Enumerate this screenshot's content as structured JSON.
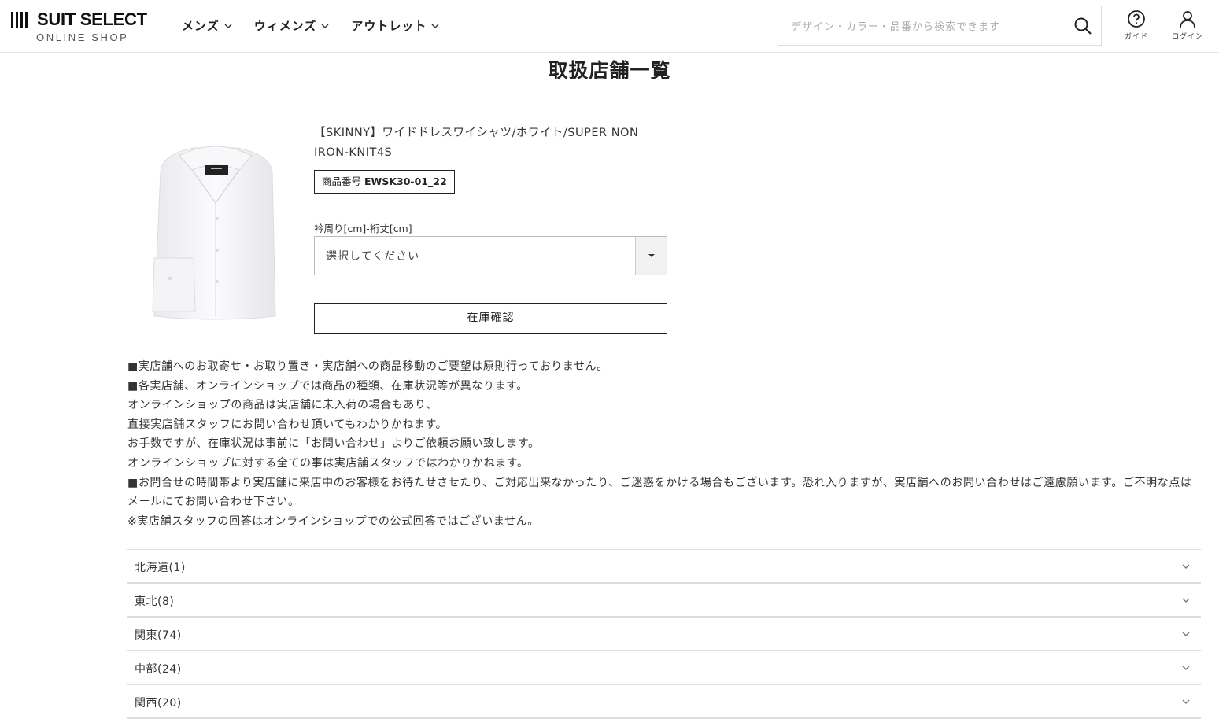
{
  "header": {
    "logo_main": "SUIT SELECT",
    "logo_sub": "ONLINE SHOP",
    "nav": [
      {
        "label": "メンズ"
      },
      {
        "label": "ウィメンズ"
      },
      {
        "label": "アウトレット"
      }
    ],
    "search_placeholder": "デザイン・カラー・品番から検索できます",
    "guide_label": "ガイド",
    "login_label": "ログイン"
  },
  "page_title": "取扱店舗一覧",
  "product": {
    "name": "【SKINNY】ワイドドレスワイシャツ/ホワイト/SUPER NON IRON-KNIT4S",
    "code_label": "商品番号",
    "code_value": "EWSK30-01_22",
    "size_label": "衿周り[cm]-裄丈[cm]",
    "size_select_value": "選択してください",
    "stock_button": "在庫確認"
  },
  "notices": [
    "■実店舗へのお取寄せ・お取り置き・実店舗への商品移動のご要望は原則行っておりません。",
    "■各実店舗、オンラインショップでは商品の種類、在庫状況等が異なります。",
    "オンラインショップの商品は実店舗に未入荷の場合もあり、",
    "直接実店舗スタッフにお問い合わせ頂いてもわかりかねます。",
    "お手数ですが、在庫状況は事前に「お問い合わせ」よりご依頼お願い致します。",
    "オンラインショップに対する全ての事は実店舗スタッフではわかりかねます。",
    "■お問合せの時間帯より実店舗に来店中のお客様をお待たせさせたり、ご対応出来なかったり、ご迷惑をかける場合もございます。恐れ入りますが、実店舗へのお問い合わせはご遠慮願います。ご不明な点はメールにてお問い合わせ下さい。",
    "※実店舗スタッフの回答はオンラインショップでの公式回答ではございません。"
  ],
  "regions": [
    {
      "label": "北海道(1)"
    },
    {
      "label": "東北(8)"
    },
    {
      "label": "関東(74)"
    },
    {
      "label": "中部(24)"
    },
    {
      "label": "関西(20)"
    }
  ]
}
